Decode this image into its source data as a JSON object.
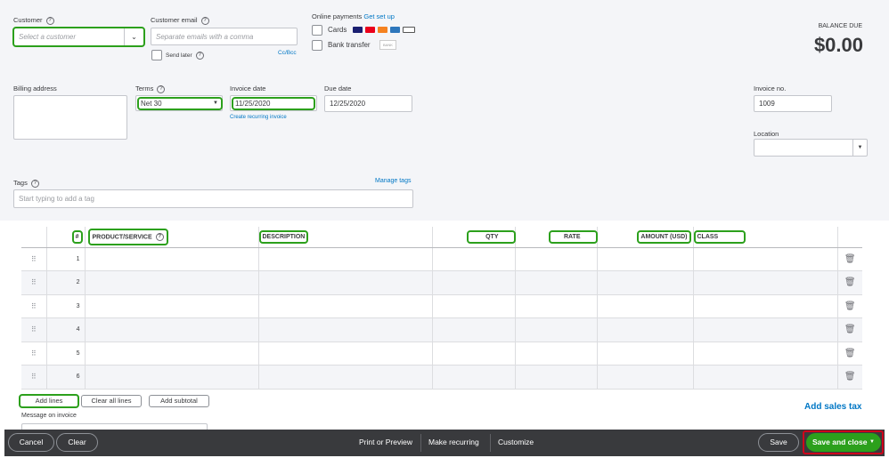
{
  "customer": {
    "label": "Customer",
    "placeholder": "Select a customer"
  },
  "email": {
    "label": "Customer email",
    "placeholder": "Separate emails with a comma",
    "send_later": "Send later",
    "cc_bcc": "Cc/Bcc"
  },
  "payments": {
    "label": "Online payments",
    "setup": "Get set up",
    "cards": "Cards",
    "bank": "Bank transfer",
    "bank_badge": "BANK"
  },
  "balance": {
    "label": "BALANCE DUE",
    "amount": "$0.00"
  },
  "billing": {
    "label": "Billing address"
  },
  "terms": {
    "label": "Terms",
    "value": "Net 30"
  },
  "invoice_date": {
    "label": "Invoice date",
    "value": "11/25/2020",
    "recurring": "Create recurring invoice"
  },
  "due_date": {
    "label": "Due date",
    "value": "12/25/2020"
  },
  "invoice_no": {
    "label": "Invoice no.",
    "value": "1009"
  },
  "location": {
    "label": "Location"
  },
  "tags": {
    "label": "Tags",
    "manage": "Manage tags",
    "placeholder": "Start typing to add a tag"
  },
  "table": {
    "headers": [
      "#",
      "PRODUCT/SERVICE",
      "DESCRIPTION",
      "QTY",
      "RATE",
      "AMOUNT (USD)",
      "CLASS"
    ],
    "rows": [
      "1",
      "2",
      "3",
      "4",
      "5",
      "6"
    ]
  },
  "actions": {
    "add_lines": "Add lines",
    "clear_lines": "Clear all lines",
    "add_subtotal": "Add subtotal",
    "message": "Message on invoice",
    "sales_tax": "Add sales tax"
  },
  "footer": {
    "cancel": "Cancel",
    "clear": "Clear",
    "print": "Print or Preview",
    "recurring": "Make recurring",
    "customize": "Customize",
    "save": "Save",
    "save_close": "Save and close"
  }
}
